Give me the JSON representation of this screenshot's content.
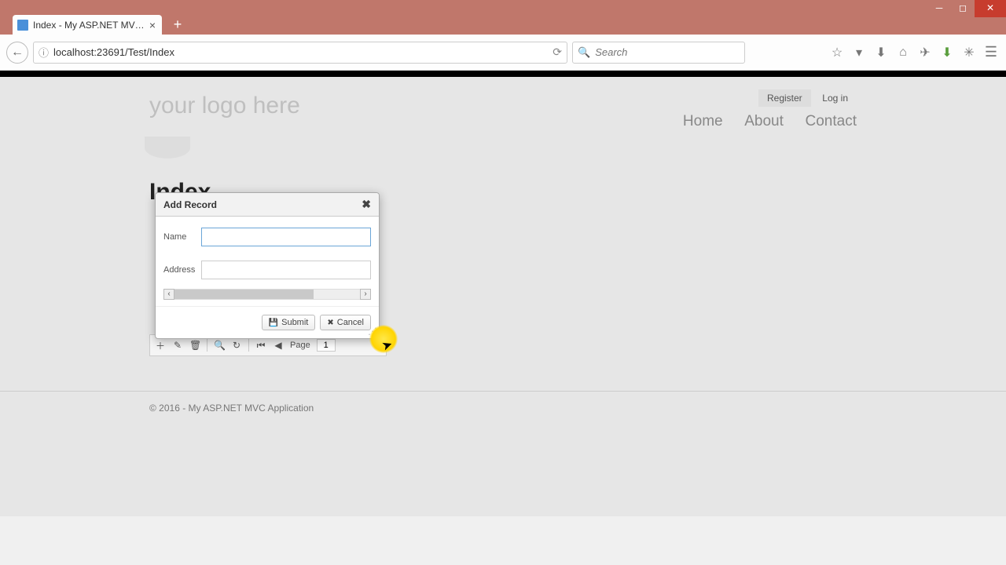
{
  "browser": {
    "tab_title": "Index - My ASP.NET MVC ...",
    "url": "localhost:23691/Test/Index",
    "search_placeholder": "Search"
  },
  "header": {
    "logo": "your logo here",
    "auth": {
      "register": "Register",
      "login": "Log in"
    },
    "nav": {
      "home": "Home",
      "about": "About",
      "contact": "Contact"
    }
  },
  "page_title": "Index",
  "dialog": {
    "title": "Add Record",
    "fields": {
      "name_label": "Name",
      "name_value": "",
      "address_label": "Address",
      "address_value": ""
    },
    "buttons": {
      "submit": "Submit",
      "cancel": "Cancel"
    }
  },
  "pager": {
    "label": "Page",
    "value": "1"
  },
  "footer": "© 2016 - My ASP.NET MVC Application"
}
